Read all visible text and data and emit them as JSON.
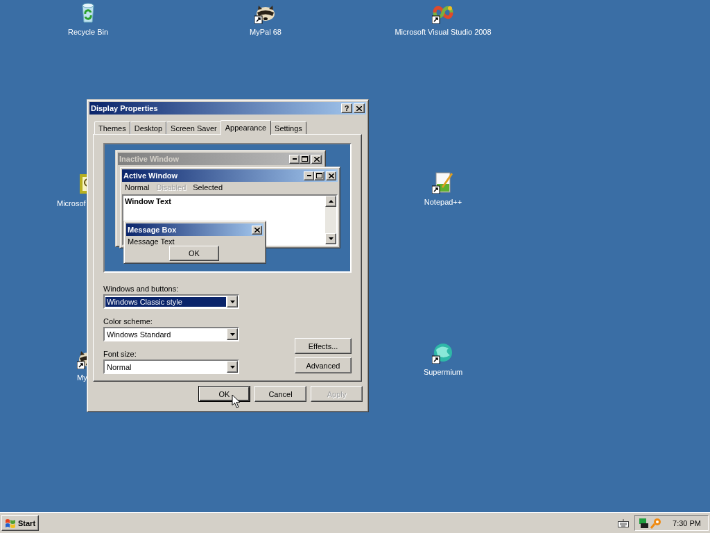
{
  "desktop": {
    "icons": [
      {
        "label": "Recycle Bin",
        "kind": "recycle",
        "shortcut": false
      },
      {
        "label": "MyPal 68",
        "kind": "raccoon",
        "shortcut": true
      },
      {
        "label": "Microsoft Visual Studio 2008",
        "kind": "infinity",
        "shortcut": true
      },
      {
        "label": "Microsof",
        "kind": "certificate",
        "shortcut": false
      },
      {
        "label": "Notepad++",
        "kind": "notepad",
        "shortcut": true
      },
      {
        "label": "My",
        "kind": "raccoon",
        "shortcut": true
      },
      {
        "label": "Supermium",
        "kind": "globe",
        "shortcut": true
      }
    ]
  },
  "dialog": {
    "title": "Display Properties",
    "help_button": "?",
    "tabs": [
      {
        "label": "Themes",
        "selected": false
      },
      {
        "label": "Desktop",
        "selected": false
      },
      {
        "label": "Screen Saver",
        "selected": false
      },
      {
        "label": "Appearance",
        "selected": true
      },
      {
        "label": "Settings",
        "selected": false
      }
    ],
    "preview": {
      "inactive_title": "Inactive Window",
      "active_title": "Active Window",
      "menu": [
        {
          "label": "Normal",
          "disabled": false
        },
        {
          "label": "Disabled",
          "disabled": true
        },
        {
          "label": "Selected",
          "disabled": false
        }
      ],
      "window_text": "Window Text",
      "message_box": {
        "title": "Message Box",
        "text": "Message Text",
        "button": "OK"
      }
    },
    "fields": [
      {
        "label": "Windows and buttons:",
        "value": "Windows Classic style",
        "focused": true
      },
      {
        "label": "Color scheme:",
        "value": "Windows Standard",
        "focused": false
      },
      {
        "label": "Font size:",
        "value": "Normal",
        "focused": false
      }
    ],
    "side_buttons": [
      "Effects...",
      "Advanced"
    ],
    "buttons": [
      {
        "label": "OK",
        "default": true,
        "disabled": false
      },
      {
        "label": "Cancel",
        "default": false,
        "disabled": false
      },
      {
        "label": "Apply",
        "default": false,
        "disabled": true
      }
    ]
  },
  "taskbar": {
    "start": "Start",
    "clock": "7:30 PM"
  }
}
